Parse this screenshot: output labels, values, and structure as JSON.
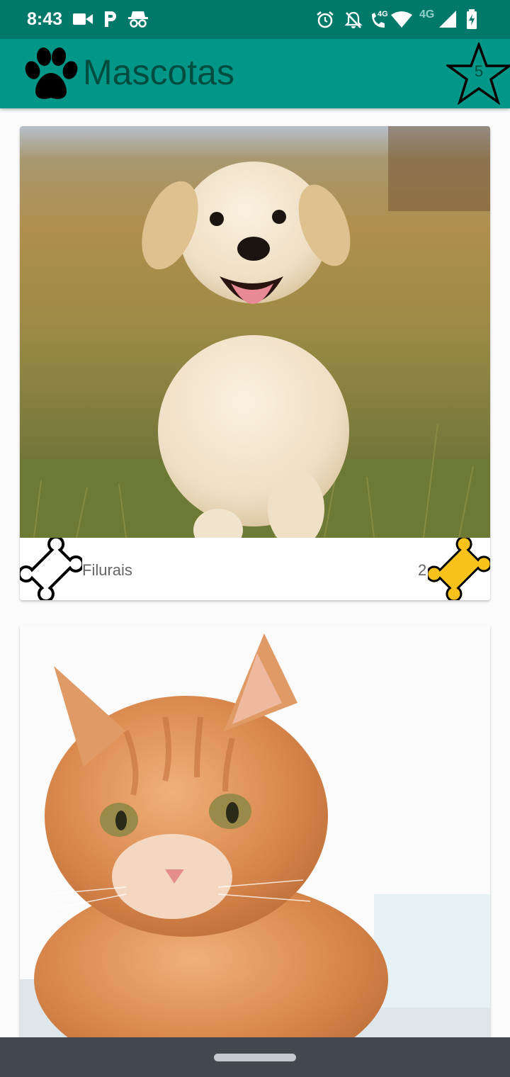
{
  "status_bar": {
    "time": "8:43",
    "icons": [
      "video-icon",
      "parking-icon",
      "incognito-icon",
      "alarm-icon",
      "notifications-off-icon",
      "wifi-calling-icon",
      "wifi-icon",
      "signal-icon",
      "battery-charging-icon"
    ],
    "network_label_call": "4G",
    "network_label": "4G"
  },
  "app_bar": {
    "title": "Mascotas",
    "logo_icon": "paw-icon",
    "favorites_icon": "star-icon",
    "favorites_count": "5",
    "background": "#009688",
    "status_color": "#00796b"
  },
  "pets": [
    {
      "photo": "puppy-photo",
      "name": "Filurais",
      "likes": "2",
      "rate_icon": "bone-outline-icon",
      "likes_icon": "bone-filled-icon",
      "likes_color": "#f9c21b"
    },
    {
      "photo": "cat-photo"
    }
  ]
}
